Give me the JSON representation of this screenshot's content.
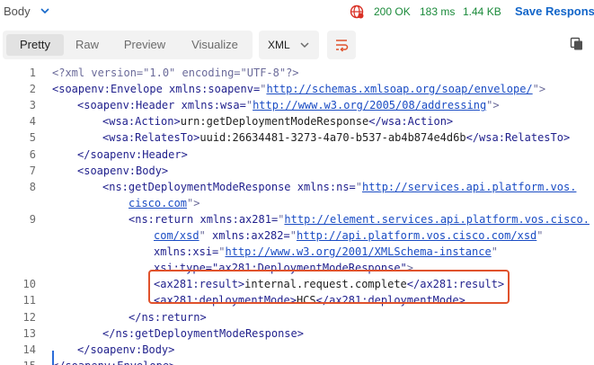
{
  "topbar": {
    "body_label": "Body",
    "status": "200 OK",
    "time": "183 ms",
    "size": "1.44 KB",
    "save_label": "Save Response"
  },
  "toolbar": {
    "tabs": [
      {
        "label": "Pretty",
        "active": true
      },
      {
        "label": "Raw",
        "active": false
      },
      {
        "label": "Preview",
        "active": false
      },
      {
        "label": "Visualize",
        "active": false
      }
    ],
    "format": "XML"
  },
  "icons": {
    "body_dropdown": "chevron-down-icon",
    "network": "globe-icon",
    "format_dropdown": "chevron-down-icon",
    "wrap": "wrap-lines-icon",
    "copy": "copy-icon"
  },
  "colors": {
    "status_ok": "#1a8a3a",
    "save": "#1366c9",
    "highlight_box": "#e0522c"
  },
  "code": {
    "lines": [
      {
        "n": "1",
        "parts": [
          [
            "p",
            "<?xml version=\"1.0\" encoding=\"UTF-8\"?>"
          ]
        ]
      },
      {
        "n": "2",
        "parts": [
          [
            "t",
            "<soapenv:Envelope "
          ],
          [
            "a",
            "xmlns:soapenv="
          ],
          [
            "p",
            "\""
          ],
          [
            "v",
            "http://schemas.xmlsoap.org/soap/envelope/"
          ],
          [
            "p",
            "\">"
          ]
        ]
      },
      {
        "n": "3",
        "parts": [
          [
            "t",
            "<soapenv:Header "
          ],
          [
            "a",
            "xmlns:wsa="
          ],
          [
            "p",
            "\""
          ],
          [
            "v",
            "http://www.w3.org/2005/08/addressing"
          ],
          [
            "p",
            "\">"
          ]
        ]
      },
      {
        "n": "4",
        "parts": [
          [
            "t",
            "<wsa:Action>"
          ],
          [
            "x",
            "urn:getDeploymentModeResponse"
          ],
          [
            "t",
            "</wsa:Action>"
          ]
        ]
      },
      {
        "n": "5",
        "parts": [
          [
            "t",
            "<wsa:RelatesTo>"
          ],
          [
            "x",
            "uuid:26634481-3273-4a70-b537-ab4b874e4d6b"
          ],
          [
            "t",
            "</wsa:RelatesTo>"
          ]
        ]
      },
      {
        "n": "6",
        "parts": [
          [
            "t",
            "</soapenv:Header>"
          ]
        ]
      },
      {
        "n": "7",
        "parts": [
          [
            "t",
            "<soapenv:Body>"
          ]
        ]
      },
      {
        "n": "8",
        "parts": [
          [
            "t",
            "<ns:getDeploymentModeResponse "
          ],
          [
            "a",
            "xmlns:ns="
          ],
          [
            "p",
            "\""
          ],
          [
            "v",
            "http://services.api.platform.vos."
          ]
        ]
      },
      {
        "n": "",
        "parts": [
          [
            "v",
            "cisco.com"
          ],
          [
            "p",
            "\">"
          ]
        ]
      },
      {
        "n": "9",
        "parts": [
          [
            "t",
            "<ns:return "
          ],
          [
            "a",
            "xmlns:ax281="
          ],
          [
            "p",
            "\""
          ],
          [
            "v",
            "http://element.services.api.platform.vos.cisco."
          ]
        ]
      },
      {
        "n": "",
        "parts": [
          [
            "v",
            "com/xsd"
          ],
          [
            "p",
            "\" "
          ],
          [
            "a",
            "xmlns:ax282="
          ],
          [
            "p",
            "\""
          ],
          [
            "v",
            "http://api.platform.vos.cisco.com/xsd"
          ],
          [
            "p",
            "\""
          ]
        ]
      },
      {
        "n": "",
        "parts": [
          [
            "a",
            "xmlns:xsi="
          ],
          [
            "p",
            "\""
          ],
          [
            "v",
            "http://www.w3.org/2001/XMLSchema-instance"
          ],
          [
            "p",
            "\""
          ]
        ]
      },
      {
        "n": "",
        "parts": [
          [
            "a",
            "xsi:type="
          ],
          [
            "sv",
            "\"ax281:DeploymentModeResponse\""
          ],
          [
            "p",
            ">"
          ]
        ]
      },
      {
        "n": "10",
        "parts": [
          [
            "t",
            "<ax281:result>"
          ],
          [
            "x",
            "internal.request.complete"
          ],
          [
            "t",
            "</ax281:result>"
          ]
        ]
      },
      {
        "n": "11",
        "parts": [
          [
            "t",
            "<ax281:deploymentMode>"
          ],
          [
            "x",
            "HCS"
          ],
          [
            "t",
            "</ax281:deploymentMode>"
          ]
        ]
      },
      {
        "n": "12",
        "parts": [
          [
            "t",
            "</ns:return>"
          ]
        ]
      },
      {
        "n": "13",
        "parts": [
          [
            "t",
            "</ns:getDeploymentModeResponse>"
          ]
        ]
      },
      {
        "n": "14",
        "parts": [
          [
            "t",
            "</soapenv:Body>"
          ]
        ]
      },
      {
        "n": "15",
        "parts": [
          [
            "t",
            "</soapenv:Envelope>"
          ]
        ]
      }
    ]
  }
}
